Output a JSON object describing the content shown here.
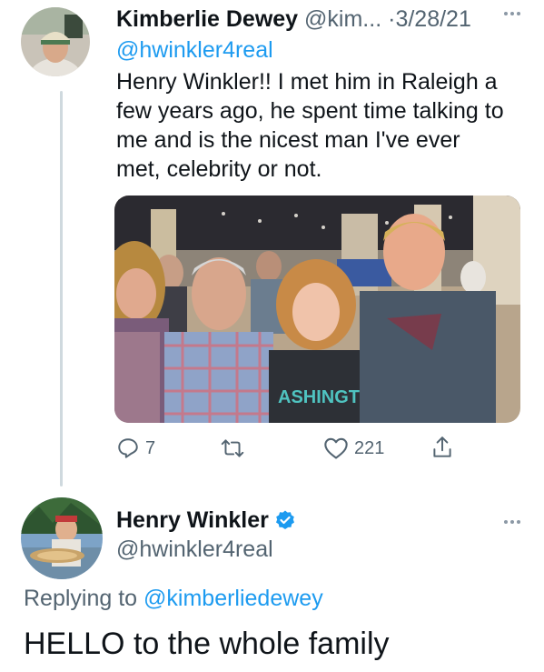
{
  "tweet1": {
    "author_name": "Kimberlie Dewey",
    "author_handle_truncated": "@kim...",
    "separator": "·",
    "date": "3/28/21",
    "more_icon": "more-dots-icon",
    "mention": "@hwinkler4real",
    "text_lines": [
      "Henry Winkler!! I met him in Raleigh a",
      "few years ago, he spent time talking to",
      "me and is the nicest man I've ever",
      "met, celebrity or not."
    ],
    "photo": {
      "shirt_text": "ASHINGT"
    },
    "actions": {
      "reply_count": "7",
      "retweet_count": "",
      "like_count": "221"
    }
  },
  "tweet2": {
    "author_name": "Henry Winkler",
    "author_handle": "@hwinkler4real",
    "verified_icon": "verified-badge-icon",
    "replying_prefix": "Replying to ",
    "replying_to": "@kimberliedewey",
    "text": "HELLO to the whole family"
  },
  "colors": {
    "link": "#1d9bf0",
    "muted": "#536471",
    "text": "#0f1419",
    "thread_line": "#cfd9de"
  }
}
